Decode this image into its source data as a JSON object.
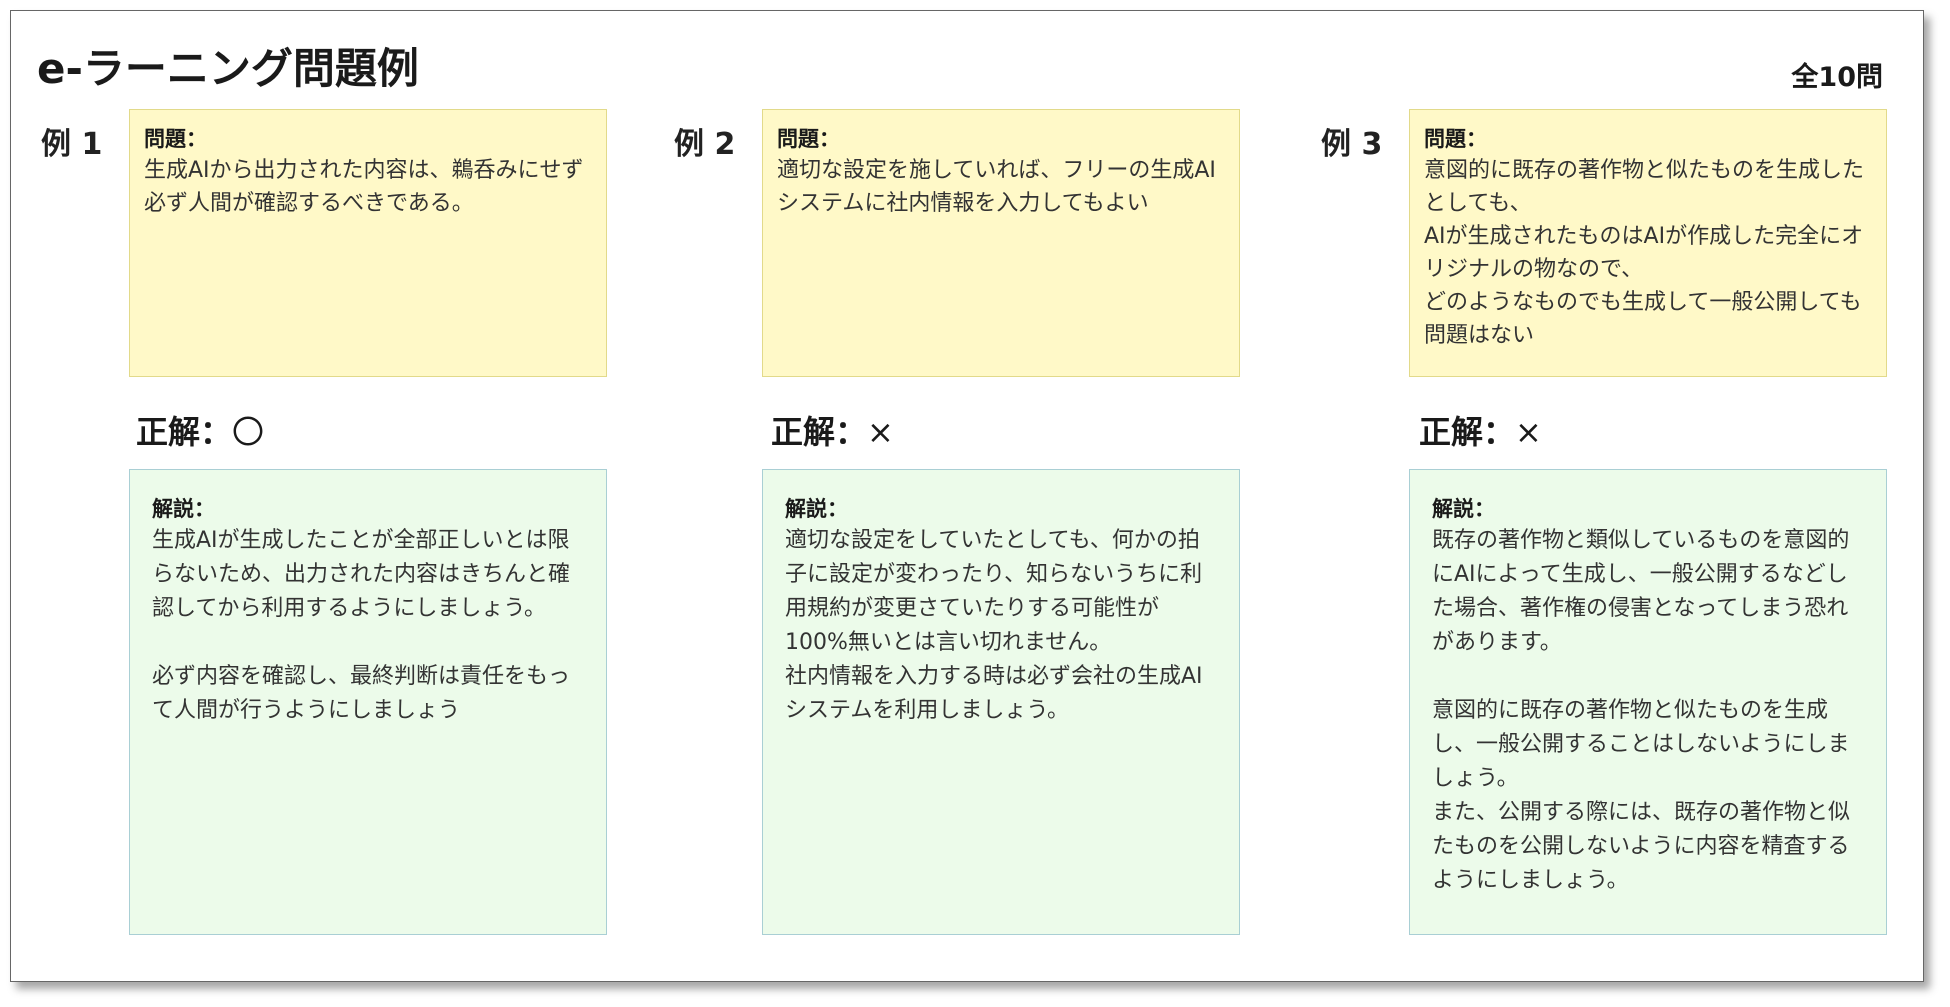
{
  "header": {
    "title": "e-ラーニング問題例",
    "count": "全10問"
  },
  "examples": [
    {
      "label": "例 1",
      "question_heading": "問題：",
      "question_text": "生成AIから出力された内容は、鵜呑みにせず必ず人間が確認するべきである。",
      "answer_label": "正解：",
      "answer_mark": "〇",
      "explanation_heading": "解説：",
      "explanation_text": "生成AIが生成したことが全部正しいとは限らないため、出力された内容はきちんと確認してから利用するようにしましょう。\n\n必ず内容を確認し、最終判断は責任をもって人間が行うようにしましょう"
    },
    {
      "label": "例 2",
      "question_heading": "問題：",
      "question_text": "適切な設定を施していれば、フリーの生成AIシステムに社内情報を入力してもよい",
      "answer_label": "正解：",
      "answer_mark": "×",
      "explanation_heading": "解説：",
      "explanation_text": "適切な設定をしていたとしても、何かの拍子に設定が変わったり、知らないうちに利用規約が変更さていたりする可能性が100%無いとは言い切れません。\n社内情報を入力する時は必ず会社の生成AIシステムを利用しましょう。"
    },
    {
      "label": "例 3",
      "question_heading": "問題：",
      "question_text": "意図的に既存の著作物と似たものを生成したとしても、\nAIが生成されたものはAIが作成した完全にオリジナルの物なので、\nどのようなものでも生成して一般公開しても問題はない",
      "answer_label": "正解：",
      "answer_mark": "×",
      "explanation_heading": "解説：",
      "explanation_text": "既存の著作物と類似しているものを意図的にAIによって生成し、一般公開するなどした場合、著作権の侵害となってしまう恐れがあります。\n\n意図的に既存の著作物と似たものを生成し、一般公開することはしないようにしましょう。\nまた、公開する際には、既存の著作物と似たものを公開しないように内容を精査するようにしましょう。"
    }
  ],
  "colors": {
    "question_bg": "#fff9c8",
    "explanation_bg": "#ecfbea",
    "explanation_border": "#a9cfd4"
  }
}
